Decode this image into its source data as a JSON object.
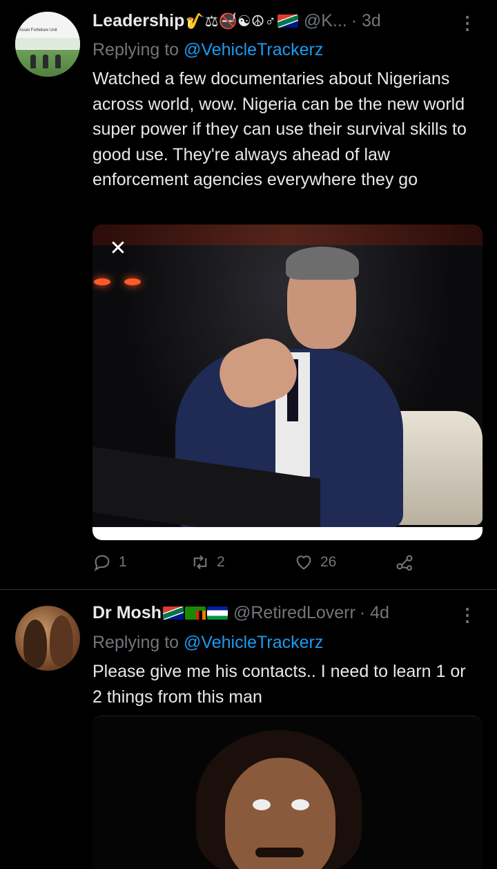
{
  "tweets": [
    {
      "name": "Leadership",
      "name_emojis": "🎷⚖🚭☯☮♂",
      "handle": "@K...",
      "time": "· 3d",
      "replying_prefix": "Replying to",
      "replying_to": "@VehicleTrackerz",
      "text": "Watched a few documentaries about Nigerians across world, wow. Nigeria can be the new world super power if they can use their survival skills to good use. They're always ahead of law enforcement agencies everywhere they go",
      "avatar_text": "Asset Forfeiture Unit",
      "actions": {
        "replies": "1",
        "retweets": "2",
        "likes": "26"
      }
    },
    {
      "name": "Dr Mosh",
      "handle": "@RetiredLoverr",
      "time": "· 4d",
      "replying_prefix": "Replying to",
      "replying_to": "@VehicleTrackerz",
      "text": "Please give me his contacts.. I need to learn 1 or 2 things from this man"
    }
  ],
  "media": {
    "close_symbol": "✕"
  },
  "icons": {
    "more": "more-vertical-icon",
    "reply": "reply-icon",
    "retweet": "retweet-icon",
    "like": "heart-icon",
    "share": "share-icon",
    "close": "close-icon"
  },
  "colors": {
    "background": "#000000",
    "text": "#e7e9ea",
    "muted": "#71767b",
    "link": "#1d9bf0"
  }
}
